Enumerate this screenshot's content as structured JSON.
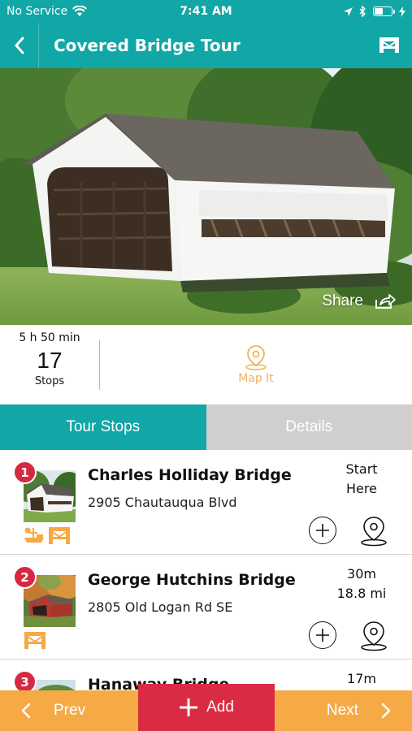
{
  "status_bar": {
    "carrier": "No Service",
    "time": "7:41 AM",
    "battery_level": 0.55
  },
  "nav": {
    "title": "Covered Bridge Tour",
    "back_icon": "chevron-left-icon",
    "right_icon": "bridge-icon"
  },
  "hero": {
    "share_label": "Share"
  },
  "summary": {
    "duration": "5 h 50 min",
    "stops_count": "17",
    "stops_label": "Stops",
    "map_label": "Map It"
  },
  "tabs": [
    {
      "label": "Tour Stops",
      "active": true
    },
    {
      "label": "Details",
      "active": false
    }
  ],
  "stops": [
    {
      "number": "1",
      "name": "Charles Holliday Bridge",
      "address": "2905 Chautauqua Blvd",
      "distance_line1": "Start",
      "distance_line2": "Here",
      "badges": [
        "picnic-icon",
        "bridge-icon"
      ]
    },
    {
      "number": "2",
      "name": "George Hutchins Bridge",
      "address": "2805 Old Logan Rd SE",
      "distance_line1": "30m",
      "distance_line2": "18.8 mi",
      "badges": [
        "bridge-icon"
      ]
    },
    {
      "number": "3",
      "name": "Hanaway Bridge",
      "address": "",
      "distance_line1": "17m",
      "distance_line2": "",
      "badges": []
    }
  ],
  "bottom_bar": {
    "prev_label": "Prev",
    "add_label": "Add",
    "next_label": "Next"
  },
  "colors": {
    "teal": "#10a7a6",
    "orange": "#f5aa45",
    "red": "#d92b43"
  }
}
